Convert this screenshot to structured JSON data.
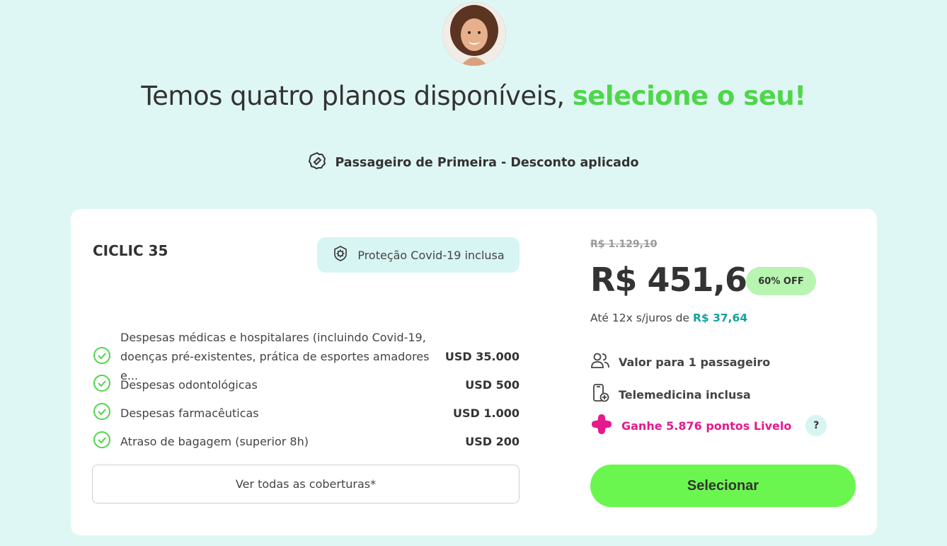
{
  "header": {
    "headline_plain": "Temos quatro planos disponíveis, ",
    "headline_accent": "selecione o seu!",
    "discount_label": "Passageiro de Primeira - Desconto aplicado"
  },
  "plan": {
    "name": "CICLIC 35",
    "covid_badge": "Proteção Covid-19 inclusa",
    "coverages": [
      {
        "label": "Despesas médicas e hospitalares (incluindo Covid-19, doenças pré-existentes, prática de esportes amadores e...",
        "value": "USD 35.000"
      },
      {
        "label": "Despesas odontológicas",
        "value": "USD 500"
      },
      {
        "label": "Despesas farmacêuticas",
        "value": "USD 1.000"
      },
      {
        "label": "Atraso de bagagem (superior 8h)",
        "value": "USD 200"
      }
    ],
    "see_all_label": "Ver todas as coberturas*",
    "old_price": "R$ 1.129,10",
    "price": "R$ 451,64",
    "discount_badge": "60% OFF",
    "installments_text": "Até 12x s/juros de ",
    "installments_amount": "R$ 37,64",
    "features": {
      "passengers": "Valor para 1 passageiro",
      "telemedicine": "Telemedicina inclusa",
      "livelo": "Ganhe 5.876 pontos Livelo"
    },
    "help_label": "?",
    "select_label": "Selecionar"
  },
  "colors": {
    "background": "#dff7f4",
    "accent_green": "#4fd64a",
    "button_green": "#6bf64f",
    "teal": "#13a39a",
    "livelo_pink": "#e6198e"
  },
  "icons": [
    "agent-avatar",
    "discount-tag-icon",
    "virus-shield-icon",
    "check-circle-icon",
    "users-icon",
    "phone-medical-icon",
    "livelo-logo-icon"
  ]
}
